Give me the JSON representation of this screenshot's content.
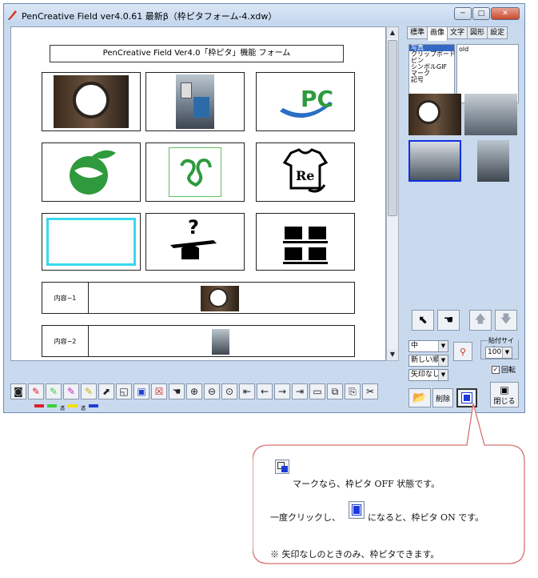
{
  "window": {
    "title": "PenCreative Field ver4.0.61 最新β（枠ピタフォーム-4.xdw）",
    "btn_min": "─",
    "btn_max": "□",
    "btn_close": "✕"
  },
  "form": {
    "title": "PenCreative Field Ver4.0「枠ピタ」機能  フォーム",
    "row1_label": "内容−1",
    "row2_label": "内容−2",
    "pc_logo_text": "PC",
    "re_logo_text": "Re"
  },
  "tabs": [
    "標準",
    "画像",
    "文字",
    "図形",
    "設定"
  ],
  "list_categories": [
    "写真",
    "クリップボード",
    "ピン",
    "シンボルGIF",
    "マーク",
    "記号"
  ],
  "list_folders": [
    "old"
  ],
  "controls": {
    "size_select": "中",
    "sort_select": "新しい順",
    "arrow_select": "矢印なし",
    "paste_size_legend": "貼付サイズ",
    "paste_size_value": "100",
    "rotate_label": "回転",
    "delete_label": "削除",
    "close_label": "閉じる"
  },
  "color_labels": [
    "透",
    "透"
  ],
  "colors": {
    "red": "#e0202a",
    "green": "#3ccf3c",
    "yellow": "#f4e000",
    "blue": "#2040d0",
    "cyan": "#37d9ef",
    "accent_green": "#2f9a3d"
  },
  "callout": {
    "line1": "マークなら、枠ピタ OFF 状態です。",
    "line2a": "一度クリックし、",
    "line2b": "になると、枠ピタ ON です。",
    "line3": "※  矢印なしのときのみ、枠ピタできます。"
  }
}
